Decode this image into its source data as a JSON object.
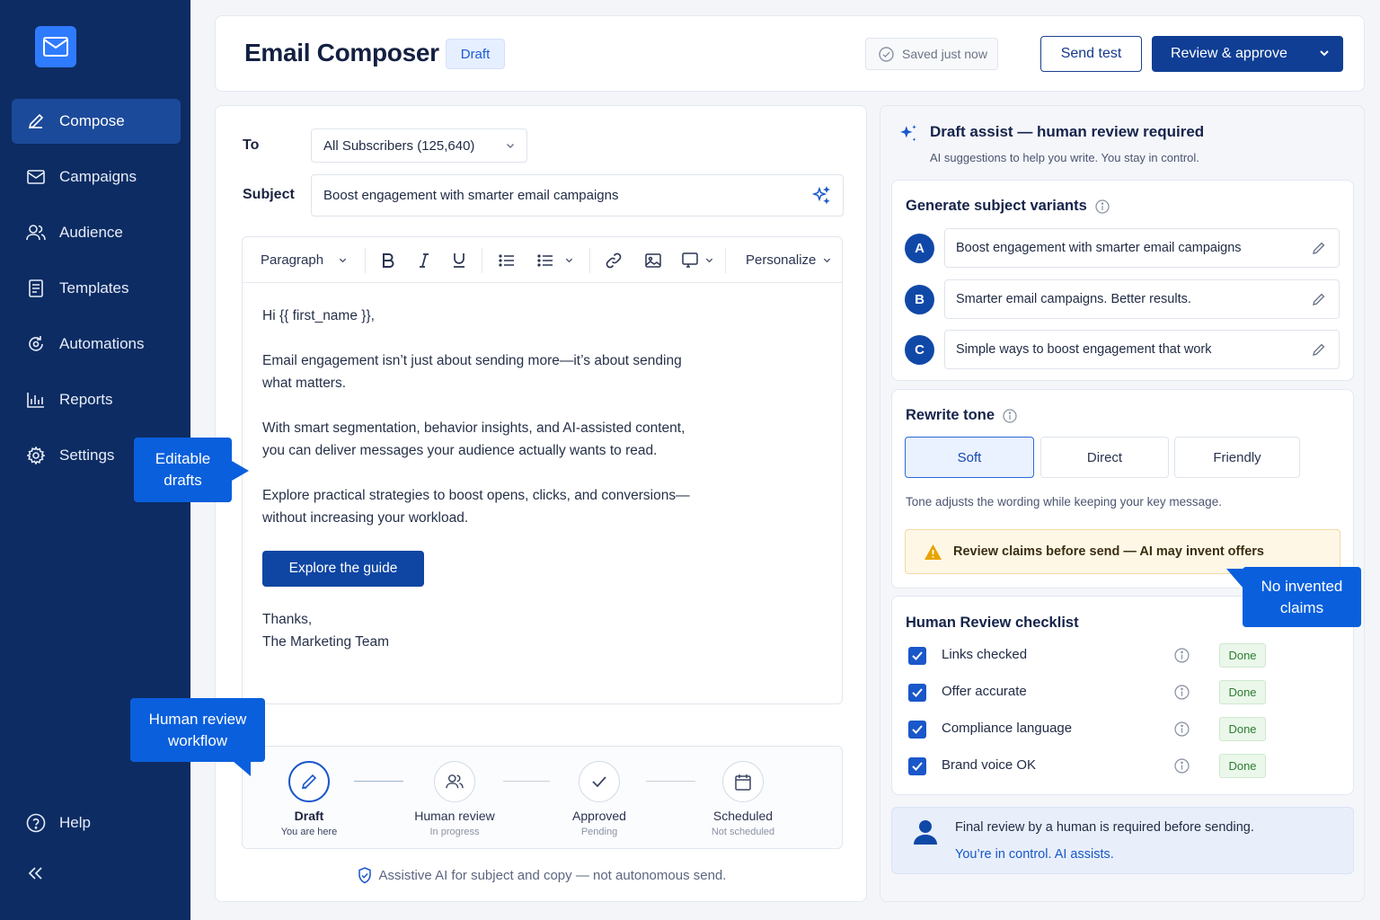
{
  "app": {
    "title": "Email Composer",
    "status_badge": "Draft",
    "saved_text": "Saved just now",
    "send_test_label": "Send test",
    "review_approve_label": "Review & approve"
  },
  "sidebar": {
    "items": [
      {
        "label": "Compose",
        "icon": "pencil-icon"
      },
      {
        "label": "Campaigns",
        "icon": "mail-icon"
      },
      {
        "label": "Audience",
        "icon": "users-icon"
      },
      {
        "label": "Templates",
        "icon": "document-icon"
      },
      {
        "label": "Automations",
        "icon": "automation-icon"
      },
      {
        "label": "Reports",
        "icon": "bar-chart-icon"
      },
      {
        "label": "Settings",
        "icon": "gear-icon"
      }
    ],
    "help_label": "Help"
  },
  "callouts": {
    "editable_drafts": "Editable drafts",
    "human_review_workflow": "Human review workflow",
    "no_invented_claims": "No invented claims"
  },
  "composer": {
    "to_label": "To",
    "to_value": "All Subscribers (125,640)",
    "subject_label": "Subject",
    "subject_value": "Boost engagement with smarter email campaigns",
    "toolbar": {
      "paragraph_label": "Paragraph",
      "personalize_label": "Personalize"
    },
    "body": {
      "greeting": "Hi {{ first_name }},",
      "p1_line1": "Email engagement isn’t just about sending more—it’s about sending",
      "p1_line2": "what matters.",
      "p2_line1": "With smart segmentation, behavior insights, and AI-assisted content,",
      "p2_line2": "you can deliver messages your audience actually wants to read.",
      "p3_line1": "Explore practical strategies to boost opens, clicks, and conversions—",
      "p3_line2": "without increasing your workload.",
      "cta_label": "Explore the guide",
      "signoff": "Thanks,",
      "signature": "The Marketing Team"
    },
    "workflow": [
      {
        "name": "Draft",
        "sub": "You are here"
      },
      {
        "name": "Human review",
        "sub": "In progress"
      },
      {
        "name": "Approved",
        "sub": "Pending"
      },
      {
        "name": "Scheduled",
        "sub": "Not scheduled"
      }
    ],
    "footer_note": "Assistive AI for subject and copy — not autonomous send."
  },
  "assist": {
    "title": "Draft assist — human review required",
    "subtitle": "AI suggestions to help you write.  You stay in control.",
    "variants_title": "Generate subject variants",
    "variants": [
      {
        "letter": "A",
        "text": "Boost engagement with smarter email campaigns"
      },
      {
        "letter": "B",
        "text": "Smarter email campaigns. Better results."
      },
      {
        "letter": "C",
        "text": "Simple ways to boost engagement that work"
      }
    ],
    "tone_title": "Rewrite tone",
    "tones": [
      "Soft",
      "Direct",
      "Friendly"
    ],
    "selected_tone": "Soft",
    "tone_note": "Tone adjusts the wording while keeping your key message.",
    "warning": "Review claims before send — AI may invent offers",
    "checklist_title": "Human Review checklist",
    "checklist": [
      {
        "label": "Links checked",
        "status": "Done"
      },
      {
        "label": "Offer accurate",
        "status": "Done"
      },
      {
        "label": "Compliance language",
        "status": "Done"
      },
      {
        "label": "Brand voice OK",
        "status": "Done"
      }
    ],
    "human_line1": "Final review by a human is required before sending.",
    "human_line2": "You’re in control. AI assists."
  },
  "colors": {
    "sidebar_bg": "#0d2c63",
    "primary": "#0f3e94",
    "accent": "#1a57c9",
    "callout": "#0a5fdd",
    "done_green": "#2e7d32",
    "warning": "#e8a300"
  }
}
